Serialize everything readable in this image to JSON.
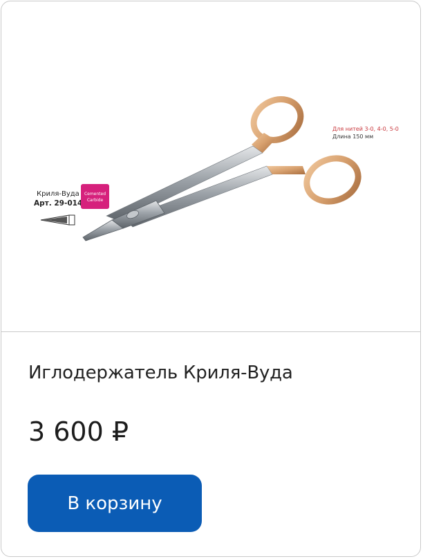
{
  "product": {
    "name": "Иглодержатель Криля-Вуда",
    "price": "3 600 ₽",
    "cart_button_label": "В корзину"
  },
  "image_labels": {
    "model_name": "Криля-Вуда",
    "article": "Арт. 29-014",
    "badge_line1": "Cemented",
    "badge_line2": "Carbide",
    "threads": "Для нитей 3-0, 4-0, 5-0",
    "length": "Длина 150 мм"
  },
  "colors": {
    "button_bg": "#0b5cb5",
    "badge_bg": "#d6207c",
    "thread_text": "#c8373c",
    "gold": "#d7a06e"
  }
}
